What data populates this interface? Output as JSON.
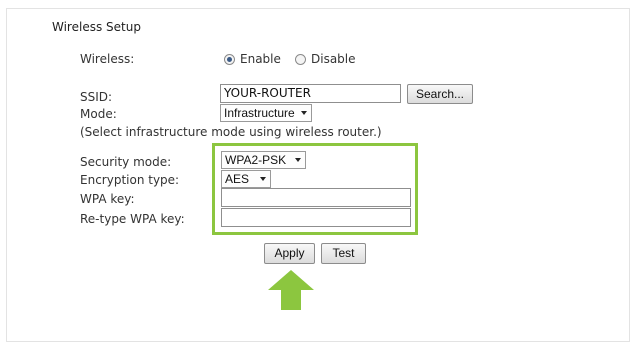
{
  "section": {
    "title": "Wireless Setup"
  },
  "wireless": {
    "label": "Wireless:",
    "options": [
      "Enable",
      "Disable"
    ],
    "selected": "Enable"
  },
  "ssid": {
    "label": "SSID:",
    "value": "YOUR-ROUTER",
    "search_label": "Search..."
  },
  "mode": {
    "label": "Mode:",
    "value": "Infrastructure",
    "note": "(Select infrastructure mode using wireless router.)"
  },
  "security": {
    "mode_label": "Security mode:",
    "mode_value": "WPA2-PSK",
    "encryption_label": "Encryption type:",
    "encryption_value": "AES",
    "wpa_key_label": "WPA key:",
    "wpa_key_value": "",
    "retype_label": "Re-type WPA key:",
    "retype_value": ""
  },
  "actions": {
    "apply_label": "Apply",
    "test_label": "Test"
  },
  "colors": {
    "highlight": "#8cc63f",
    "arrow": "#8cc63f"
  },
  "icons": {
    "pointer": "up-arrow-icon"
  }
}
